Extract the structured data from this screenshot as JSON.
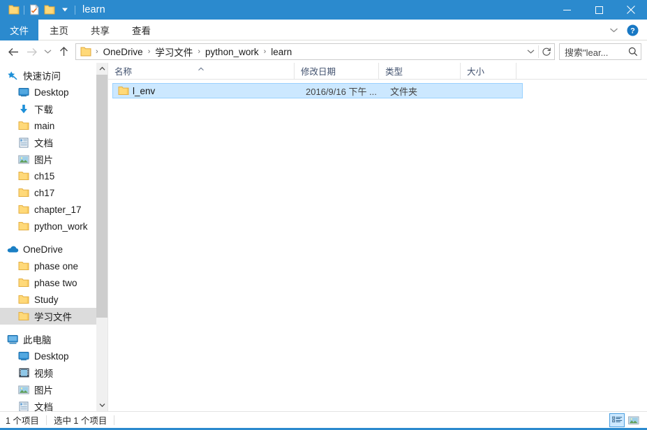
{
  "window": {
    "title": "learn",
    "quick_access": [
      {
        "name": "folder-icon",
        "label": "属性"
      },
      {
        "name": "checklist-icon",
        "label": "新建文件夹"
      },
      {
        "name": "folder-icon",
        "label": "文件夹"
      },
      {
        "name": "chevron-down-icon",
        "label": "自定义快速访问工具栏"
      }
    ],
    "controls": {
      "minimize": "最小化",
      "maximize": "最大化",
      "close": "关闭"
    }
  },
  "ribbon": {
    "tabs": [
      {
        "label": "文件",
        "active": true
      },
      {
        "label": "主页",
        "active": false
      },
      {
        "label": "共享",
        "active": false
      },
      {
        "label": "查看",
        "active": false
      }
    ],
    "collapse_label": "展开功能区",
    "help_label": "帮助"
  },
  "address": {
    "back_label": "后退",
    "forward_label": "前进",
    "recent_label": "最近浏览的位置",
    "up_label": "上移到",
    "breadcrumbs": [
      "OneDrive",
      "学习文件",
      "python_work",
      "learn"
    ],
    "separator": "›",
    "dropdown_label": "前往",
    "refresh_label": "刷新",
    "search": {
      "value": "",
      "placeholder": "搜索\"lear...",
      "icon": "search-icon"
    }
  },
  "sidebar": {
    "groups": [
      {
        "header": {
          "label": "快速访问",
          "icon": "star-pin-icon"
        },
        "items": [
          {
            "label": "Desktop",
            "icon": "desktop-icon",
            "pinned": true
          },
          {
            "label": "下载",
            "icon": "download-icon",
            "pinned": true
          },
          {
            "label": "main",
            "icon": "folder-icon",
            "pinned": true
          },
          {
            "label": "文档",
            "icon": "documents-icon",
            "pinned": true
          },
          {
            "label": "图片",
            "icon": "pictures-icon",
            "pinned": true
          },
          {
            "label": "ch15",
            "icon": "folder-icon",
            "pinned": false
          },
          {
            "label": "ch17",
            "icon": "folder-icon",
            "pinned": false
          },
          {
            "label": "chapter_17",
            "icon": "folder-icon",
            "pinned": false
          },
          {
            "label": "python_work",
            "icon": "folder-icon",
            "pinned": false
          }
        ]
      },
      {
        "header": {
          "label": "OneDrive",
          "icon": "cloud-icon"
        },
        "items": [
          {
            "label": "phase one",
            "icon": "folder-icon",
            "pinned": false
          },
          {
            "label": "phase two",
            "icon": "folder-icon",
            "pinned": false
          },
          {
            "label": "Study",
            "icon": "folder-icon",
            "pinned": false
          },
          {
            "label": "学习文件",
            "icon": "folder-icon",
            "pinned": false,
            "selected": true
          }
        ]
      },
      {
        "header": {
          "label": "此电脑",
          "icon": "computer-icon"
        },
        "items": [
          {
            "label": "Desktop",
            "icon": "desktop-icon",
            "pinned": false
          },
          {
            "label": "视频",
            "icon": "videos-icon",
            "pinned": false
          },
          {
            "label": "图片",
            "icon": "pictures-icon",
            "pinned": false
          },
          {
            "label": "文档",
            "icon": "documents-icon",
            "pinned": false
          }
        ]
      }
    ],
    "scrollbar": {
      "up_label": "向上滚动",
      "down_label": "向下滚动"
    }
  },
  "filelist": {
    "columns": [
      {
        "label": "名称",
        "sorted": "asc"
      },
      {
        "label": "修改日期",
        "sorted": ""
      },
      {
        "label": "类型",
        "sorted": ""
      },
      {
        "label": "大小",
        "sorted": ""
      }
    ],
    "rows": [
      {
        "name": "l_env",
        "date": "2016/9/16 下午 ...",
        "type": "文件夹",
        "size": "",
        "icon": "folder-icon",
        "selected": true
      }
    ]
  },
  "statusbar": {
    "item_count": "1 个项目",
    "selection": "选中 1 个项目",
    "views": [
      {
        "name": "details-view-button",
        "label": "详细信息",
        "active": true
      },
      {
        "name": "large-icons-view-button",
        "label": "大图标",
        "active": false
      }
    ]
  }
}
